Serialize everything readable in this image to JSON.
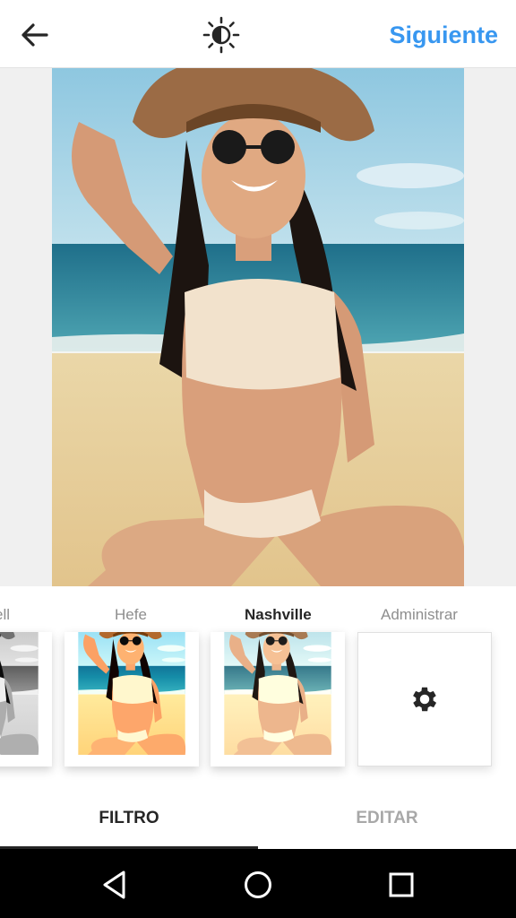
{
  "header": {
    "back_icon": "arrow-left-icon",
    "lux_icon": "lux-brightness-icon",
    "next_label": "Siguiente",
    "accent_color": "#3897f0"
  },
  "filters": {
    "items": [
      {
        "label": "ell"
      },
      {
        "label": "Hefe"
      },
      {
        "label": "Nashville",
        "selected": true
      },
      {
        "label": "Administrar",
        "icon": "gear-icon"
      }
    ]
  },
  "tabs": {
    "filter_label": "FILTRO",
    "edit_label": "EDITAR",
    "active": "FILTRO"
  },
  "navbar": {
    "icons": [
      "back-triangle-icon",
      "home-circle-icon",
      "recents-square-icon"
    ]
  }
}
